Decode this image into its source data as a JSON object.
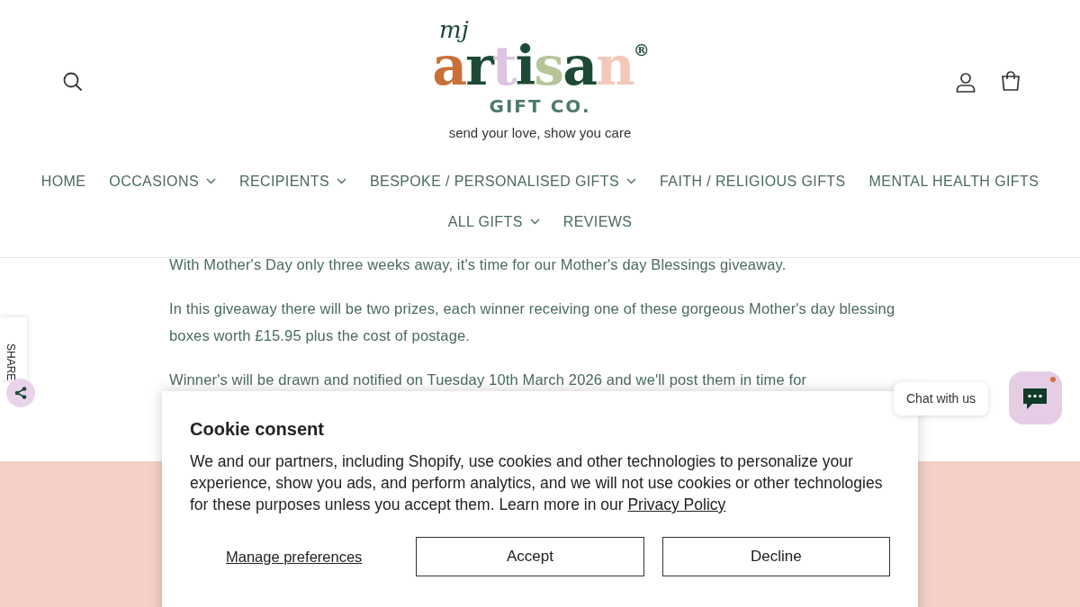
{
  "header": {
    "logo": {
      "script": "mj",
      "letters": [
        {
          "text": "a",
          "color": "#c8703a"
        },
        {
          "text": "r",
          "color": "#1d4a36"
        },
        {
          "text": "t",
          "color": "#dcc4e2"
        },
        {
          "text": "i",
          "color": "#1d4a36"
        },
        {
          "text": "s",
          "color": "#b7c497"
        },
        {
          "text": "a",
          "color": "#1d4a36"
        },
        {
          "text": "n",
          "color": "#f3c8bb"
        }
      ],
      "registered": "®",
      "subtitle": "GIFT CO.",
      "tagline": "send your love, show you care"
    }
  },
  "nav": [
    [
      {
        "label": "HOME",
        "dropdown": false
      },
      {
        "label": "OCCASIONS",
        "dropdown": true
      },
      {
        "label": "RECIPIENTS",
        "dropdown": true
      },
      {
        "label": "BESPOKE / PERSONALISED GIFTS",
        "dropdown": true
      },
      {
        "label": "FAITH / RELIGIOUS GIFTS",
        "dropdown": false
      },
      {
        "label": "MENTAL HEALTH GIFTS",
        "dropdown": false
      }
    ],
    [
      {
        "label": "ALL GIFTS",
        "dropdown": true
      },
      {
        "label": "REVIEWS",
        "dropdown": false
      }
    ]
  ],
  "article": [
    "With Mother's Day only three weeks away, it's time for our Mother's day Blessings giveaway.",
    "In this giveaway there will be two prizes, each winner receiving one of these gorgeous Mother's day blessing boxes worth £15.95 plus the cost of postage.",
    "Winner's will be drawn and notified on Tuesday 10th March 2026 and we'll post them in time for"
  ],
  "share": {
    "label": "SHARE"
  },
  "chat": {
    "label": "Chat with us",
    "unread": true
  },
  "cookie": {
    "title": "Cookie consent",
    "text": "We and our partners, including Shopify, use cookies and other technologies to personalize your experience, show you ads, and perform analytics, and we will not use cookies or other technologies for these purposes unless you accept them. Learn more in our",
    "link": "Privacy Policy",
    "manage": "Manage preferences",
    "buttons": [
      "Accept",
      "Decline"
    ]
  }
}
